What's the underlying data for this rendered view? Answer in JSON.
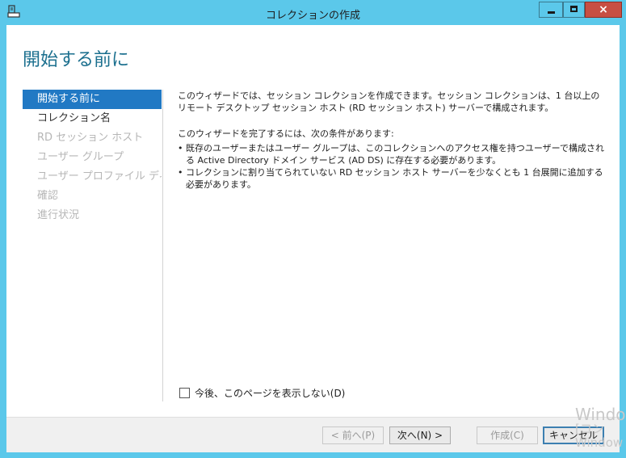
{
  "window": {
    "title": "コレクションの作成",
    "icon": "wizard-app-icon",
    "close_label": "×"
  },
  "page_title": "開始する前に",
  "nav": {
    "items": [
      {
        "label": "開始する前に",
        "state": "selected"
      },
      {
        "label": "コレクション名",
        "state": "enabled"
      },
      {
        "label": "RD セッション ホスト",
        "state": "disabled"
      },
      {
        "label": "ユーザー グループ",
        "state": "disabled"
      },
      {
        "label": "ユーザー プロファイル ディスク",
        "state": "disabled"
      },
      {
        "label": "確認",
        "state": "disabled"
      },
      {
        "label": "進行状況",
        "state": "disabled"
      }
    ]
  },
  "content": {
    "intro": "このウィザードでは、セッション コレクションを作成できます。セッション コレクションは、1 台以上のリモート デスクトップ セッション ホスト (RD セッション ホスト) サーバーで構成されます。",
    "prereq_heading": "このウィザードを完了するには、次の条件があります:",
    "bullets": [
      "既存のユーザーまたはユーザー グループは、このコレクションへのアクセス権を持つユーザーで構成される Active Directory ドメイン サービス (AD DS) に存在する必要があります。",
      "コレクションに割り当てられていない RD セッション ホスト サーバーを少なくとも 1 台展開に追加する必要があります。"
    ]
  },
  "checkbox": {
    "label": "今後、このページを表示しない(D)",
    "checked": false
  },
  "footer": {
    "prev_label": "< 前へ(P)",
    "next_label": "次へ(N) >",
    "create_label": "作成(C)",
    "cancel_label": "キャンセル"
  },
  "watermark": {
    "line1": "Windo",
    "line2": "[コン",
    "line3": "Window"
  },
  "colors": {
    "titlebar": "#5bc8ea",
    "page_title": "#1b6f8e",
    "nav_selected": "#2179c4",
    "close_button": "#c74f43"
  }
}
